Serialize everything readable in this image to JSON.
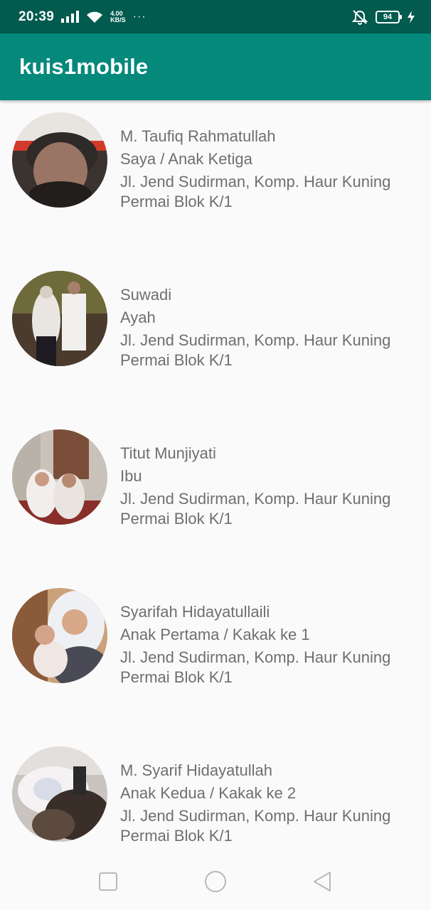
{
  "status_bar": {
    "time": "20:39",
    "net_speed_value": "4.00",
    "net_speed_unit": "KB/S",
    "more": "···",
    "battery": "94",
    "icons": [
      "signal-icon",
      "wifi-icon",
      "mute-icon",
      "battery-icon",
      "charging-bolt-icon"
    ]
  },
  "app_bar": {
    "title": "kuis1mobile",
    "color": "#04897b"
  },
  "list": {
    "items": [
      {
        "name": "M. Taufiq Rahmatullah",
        "role": "Saya / Anak Ketiga",
        "address": "Jl. Jend Sudirman, Komp. Haur Kuning Permai Blok K/1"
      },
      {
        "name": "Suwadi",
        "role": "Ayah",
        "address": "Jl. Jend Sudirman, Komp. Haur Kuning Permai Blok K/1"
      },
      {
        "name": "Titut Munjiyati",
        "role": "Ibu",
        "address": "Jl. Jend Sudirman, Komp. Haur Kuning Permai Blok K/1"
      },
      {
        "name": "Syarifah Hidayatullaili",
        "role": "Anak Pertama / Kakak ke 1",
        "address": "Jl. Jend Sudirman, Komp. Haur Kuning Permai Blok K/1"
      },
      {
        "name": "M. Syarif Hidayatullah",
        "role": "Anak Kedua / Kakak ke 2",
        "address": "Jl. Jend Sudirman, Komp. Haur Kuning Permai Blok K/1"
      }
    ]
  },
  "nav_bar": {
    "icons": [
      "recent-apps-icon",
      "home-icon",
      "back-icon"
    ]
  }
}
